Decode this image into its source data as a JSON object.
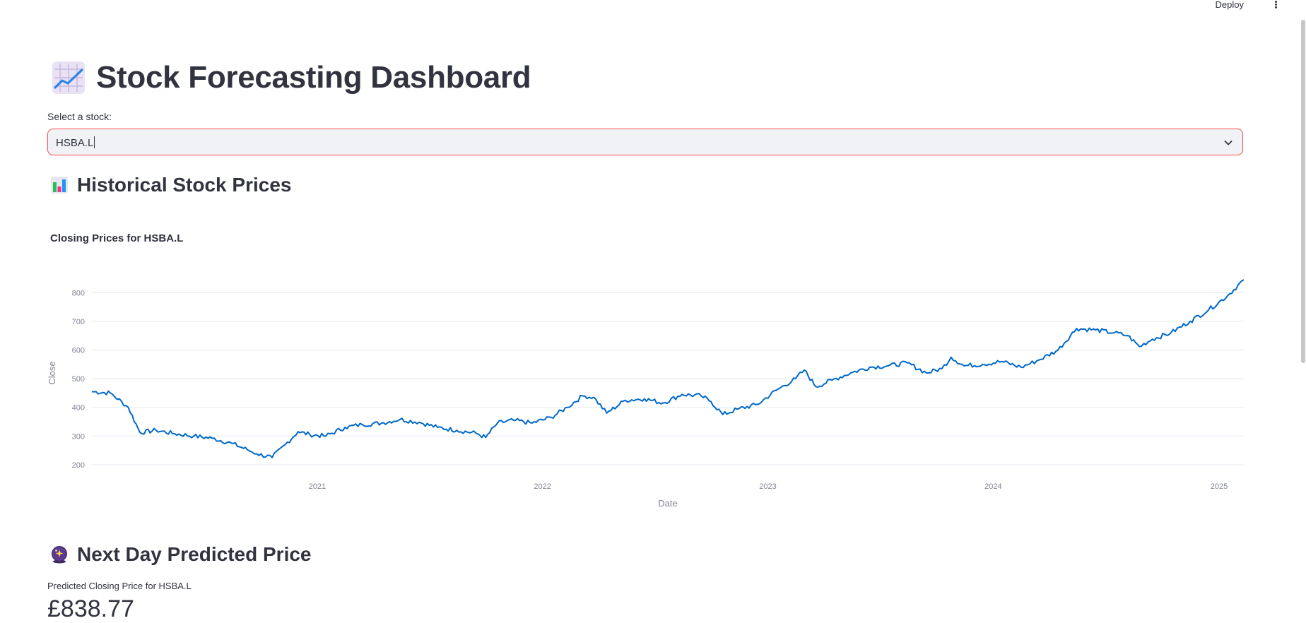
{
  "header": {
    "deploy_label": "Deploy",
    "menu_icon": "vertical-dots-icon"
  },
  "page": {
    "title": "Stock Forecasting Dashboard",
    "title_icon": "chart-increasing-icon"
  },
  "stock_select": {
    "label": "Select a stock:",
    "value": "HSBA.L",
    "chevron_icon": "chevron-down-icon",
    "focus_border_color": "#ff4b4b"
  },
  "historical": {
    "heading": "Historical Stock Prices",
    "heading_icon": "bar-chart-icon"
  },
  "prediction": {
    "heading": "Next Day Predicted Price",
    "heading_icon": "crystal-ball-icon",
    "metric_label": "Predicted Closing Price for HSBA.L",
    "metric_value": "£838.77"
  },
  "chart_data": {
    "type": "line",
    "title": "Closing Prices for HSBA.L",
    "xlabel": "Date",
    "ylabel": "Close",
    "x_ticks": [
      "2021",
      "2022",
      "2023",
      "2024",
      "2025"
    ],
    "y_ticks": [
      200,
      300,
      400,
      500,
      600,
      700,
      800
    ],
    "ylim": [
      180,
      860
    ],
    "xlim": [
      "2020-01-02",
      "2025-02-10"
    ],
    "grid": true,
    "line_color": "#0068c9",
    "series": [
      {
        "x": [
          "2020-01-02",
          "2020-02-01",
          "2020-03-01",
          "2020-03-20",
          "2020-04-15",
          "2020-05-15",
          "2020-06-15",
          "2020-07-15",
          "2020-08-15",
          "2020-09-10",
          "2020-09-25",
          "2020-10-20",
          "2020-11-10",
          "2020-12-01",
          "2020-12-20",
          "2021-01-15",
          "2021-02-15",
          "2021-03-15",
          "2021-04-15",
          "2021-05-15",
          "2021-06-15",
          "2021-07-15",
          "2021-08-15",
          "2021-09-15",
          "2021-10-01",
          "2021-10-20",
          "2021-11-15",
          "2021-12-15",
          "2022-01-15",
          "2022-02-10",
          "2022-03-07",
          "2022-03-25",
          "2022-04-15",
          "2022-05-15",
          "2022-06-15",
          "2022-07-15",
          "2022-08-15",
          "2022-09-15",
          "2022-10-01",
          "2022-10-20",
          "2022-11-15",
          "2022-12-15",
          "2023-01-15",
          "2023-02-15",
          "2023-03-01",
          "2023-03-20",
          "2023-04-15",
          "2023-05-15",
          "2023-06-15",
          "2023-07-15",
          "2023-08-15",
          "2023-09-15",
          "2023-10-10",
          "2023-10-25",
          "2023-11-15",
          "2023-12-15",
          "2024-01-15",
          "2024-02-15",
          "2024-03-15",
          "2024-04-15",
          "2024-05-15",
          "2024-06-15",
          "2024-07-15",
          "2024-08-06",
          "2024-08-25",
          "2024-09-15",
          "2024-10-15",
          "2024-11-15",
          "2024-12-15",
          "2025-01-15",
          "2025-02-10"
        ],
        "y": [
          455,
          450,
          400,
          312,
          320,
          308,
          300,
          292,
          275,
          252,
          238,
          225,
          270,
          315,
          305,
          300,
          330,
          340,
          345,
          358,
          348,
          330,
          320,
          310,
          295,
          345,
          355,
          345,
          365,
          400,
          440,
          435,
          380,
          425,
          430,
          415,
          445,
          440,
          420,
          375,
          395,
          410,
          460,
          500,
          530,
          472,
          495,
          520,
          540,
          545,
          555,
          520,
          535,
          575,
          545,
          550,
          560,
          540,
          565,
          600,
          675,
          670,
          660,
          650,
          612,
          638,
          660,
          700,
          740,
          790,
          845
        ]
      }
    ]
  }
}
